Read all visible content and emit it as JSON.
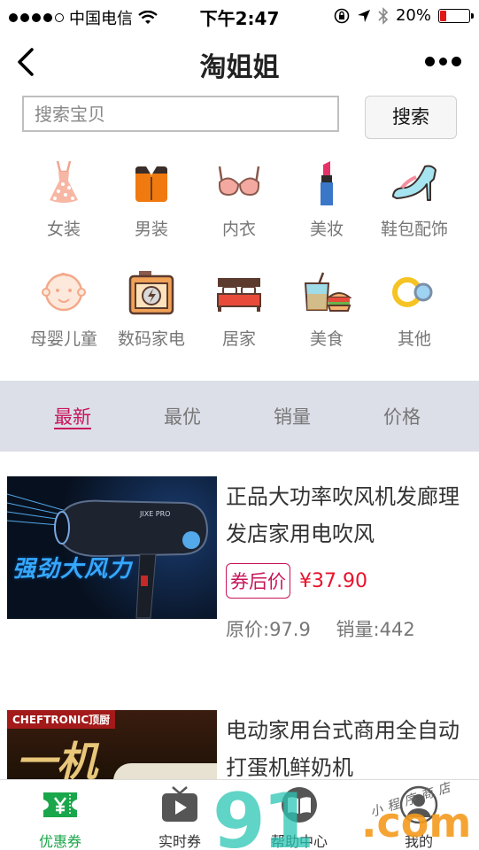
{
  "status_bar": {
    "carrier": "中国电信",
    "time": "下午2:47",
    "battery": "20%",
    "battery_level": 0.2
  },
  "nav": {
    "title": "淘姐姐"
  },
  "search": {
    "placeholder": "搜索宝贝",
    "button": "搜索"
  },
  "categories": [
    {
      "label": "女装",
      "icon": "dress-icon"
    },
    {
      "label": "男装",
      "icon": "shirt-icon"
    },
    {
      "label": "内衣",
      "icon": "bra-icon"
    },
    {
      "label": "美妆",
      "icon": "lipstick-icon"
    },
    {
      "label": "鞋包配饰",
      "icon": "high-heel-icon"
    },
    {
      "label": "母婴儿童",
      "icon": "baby-icon"
    },
    {
      "label": "数码家电",
      "icon": "camera-icon"
    },
    {
      "label": "居家",
      "icon": "bed-icon"
    },
    {
      "label": "美食",
      "icon": "food-icon"
    },
    {
      "label": "其他",
      "icon": "rings-icon"
    }
  ],
  "sort_tabs": [
    {
      "label": "最新",
      "active": true
    },
    {
      "label": "最优",
      "active": false
    },
    {
      "label": "销量",
      "active": false
    },
    {
      "label": "价格",
      "active": false
    }
  ],
  "products": [
    {
      "title": "正品大功率吹风机发廊理发店家用电吹风",
      "image_text": "强劲大风力",
      "image_brand": "JIXE PRO",
      "coupon_label": "券后价",
      "price": "¥37.90",
      "original_price_label": "原价:",
      "original_price": "97.9",
      "sales_label": "销量:",
      "sales": "442"
    },
    {
      "title": "电动家用台式商用全自动打蛋机鲜奶机",
      "image_brand": "CHEFTRONIC顶厨",
      "image_text": "一机"
    }
  ],
  "tab_bar": [
    {
      "label": "优惠券",
      "icon": "coupon-icon",
      "active": true
    },
    {
      "label": "实时券",
      "icon": "play-tv-icon",
      "active": false
    },
    {
      "label": "帮助中心",
      "icon": "help-book-icon",
      "active": false
    },
    {
      "label": "我的",
      "icon": "user-icon",
      "active": false
    }
  ],
  "watermark": {
    "brand": "91",
    "domain": ".com",
    "subtitle": "小程序商店"
  },
  "colors": {
    "accent": "#c8155a",
    "price": "#e8132b",
    "tab_active": "#1aa64a",
    "sort_bg": "#dcdfe8"
  }
}
